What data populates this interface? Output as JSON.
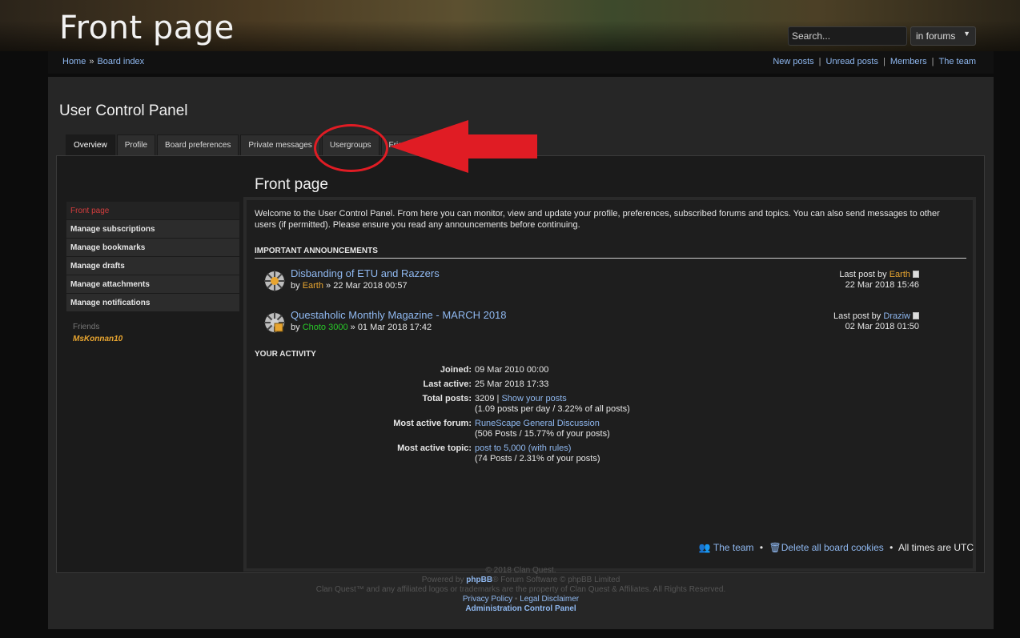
{
  "header": {
    "site_title": "Front page",
    "search_placeholder": "Search...",
    "search_scope": "in forums"
  },
  "nav": {
    "home": "Home",
    "board_index": "Board index",
    "new_posts": "New posts",
    "unread_posts": "Unread posts",
    "members": "Members",
    "the_team": "The team"
  },
  "ucp": {
    "title": "User Control Panel",
    "tabs": [
      "Overview",
      "Profile",
      "Board preferences",
      "Private messages",
      "Usergroups",
      "Friends"
    ],
    "active_tab": "Overview",
    "side_menu": [
      "Front page",
      "Manage subscriptions",
      "Manage bookmarks",
      "Manage drafts",
      "Manage attachments",
      "Manage notifications"
    ],
    "friends_label": "Friends",
    "friends": [
      "MsKonnan10"
    ]
  },
  "content": {
    "title": "Front page",
    "welcome": "Welcome to the User Control Panel. From here you can monitor, view and update your profile, preferences, subscribed forums and topics. You can also send messages to other users (if permitted). Please ensure you read any announcements before continuing.",
    "announcements_heading": "IMPORTANT ANNOUNCEMENTS",
    "topics": [
      {
        "title": "Disbanding of ETU and Razzers",
        "by_label": "by",
        "author": "Earth",
        "date": "» 22 Mar 2018 00:57",
        "last_post_label": "Last post by",
        "last_author": "Earth",
        "last_date": "22 Mar 2018 15:46"
      },
      {
        "title": "Questaholic Monthly Magazine - MARCH 2018",
        "by_label": "by",
        "author": "Choto 3000",
        "date": "» 01 Mar 2018 17:42",
        "last_post_label": "Last post by",
        "last_author": "Draziw",
        "last_date": "02 Mar 2018 01:50"
      }
    ],
    "activity_heading": "YOUR ACTIVITY",
    "activity": {
      "joined_label": "Joined:",
      "joined": "09 Mar 2010 00:00",
      "last_active_label": "Last active:",
      "last_active": "25 Mar 2018 17:33",
      "total_posts_label": "Total posts:",
      "total_posts": "3209 |",
      "show_posts": "Show your posts",
      "posts_detail": "(1.09 posts per day / 3.22% of all posts)",
      "active_forum_label": "Most active forum:",
      "active_forum": "RuneScape General Discussion",
      "active_forum_detail": "(506 Posts / 15.77% of your posts)",
      "active_topic_label": "Most active topic:",
      "active_topic": "post to 5,000 (with rules)",
      "active_topic_detail": "(74 Posts / 2.31% of your posts)"
    }
  },
  "footer": {
    "the_team": "The team",
    "delete_cookies": "Delete all board cookies",
    "timezone": "All times are UTC",
    "copyright": "© 2018 Clan Quest.",
    "powered_prefix": "Powered by",
    "phpbb": "phpBB",
    "powered_suffix": "® Forum Software © phpBB Limited",
    "trademark": "Clan Quest™ and any affiliated logos or trademarks are the property of Clan Quest & Affiliates. All Rights Reserved.",
    "privacy": "Privacy Policy",
    "legal": "Legal Disclaimer",
    "acp": "Administration Control Panel"
  },
  "colors": {
    "accent_link": "#8fb8f0",
    "active_menu": "#d33d3d",
    "annotation_red": "#e01c24",
    "user_gold": "#e8a530",
    "user_green": "#28c828"
  }
}
